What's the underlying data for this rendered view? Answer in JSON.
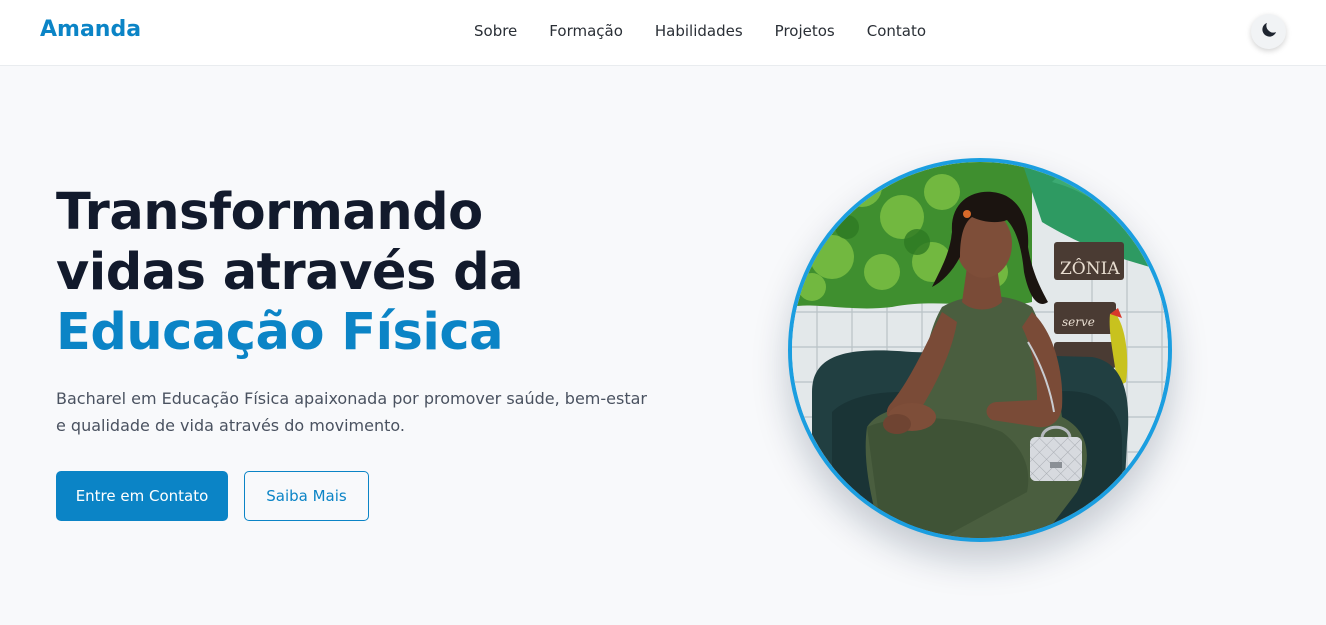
{
  "nav": {
    "brand": "Amanda",
    "links": [
      "Sobre",
      "Formação",
      "Habilidades",
      "Projetos",
      "Contato"
    ],
    "theme_toggle_icon": "moon-icon"
  },
  "hero": {
    "title_line1": "Transformando",
    "title_line2": "vidas através da",
    "title_accent": "Educação Física",
    "description": "Bacharel em Educação Física apaixonada por promover saúde, bem-estar e qualidade de vida através do movimento.",
    "primary_button": "Entre em Contato",
    "secondary_button": "Saiba Mais",
    "photo_sign_text": "ZÔNIA",
    "photo_sign_text2": "serve"
  },
  "colors": {
    "accent": "#0b84c6",
    "heading": "#121a2c",
    "background": "#f8f9fb",
    "photo_border": "#1b9ee0"
  }
}
